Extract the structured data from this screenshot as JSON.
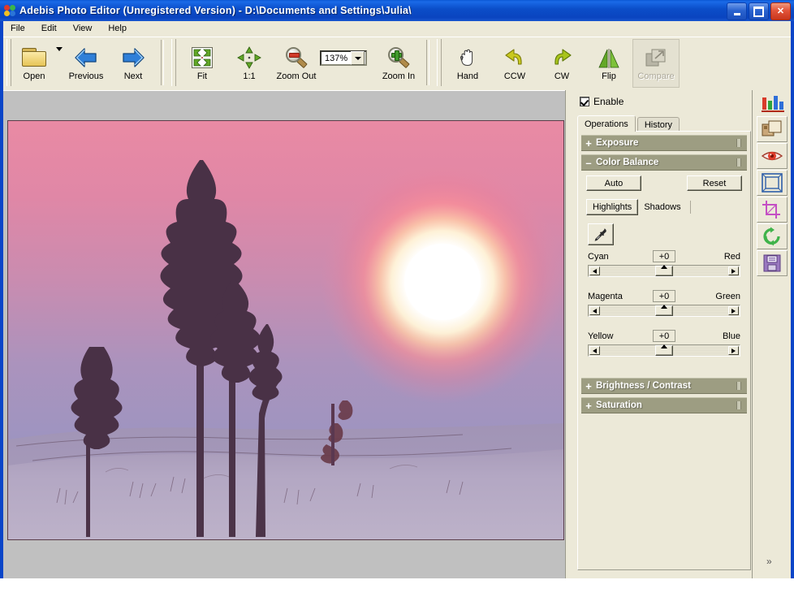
{
  "window": {
    "title": "Adebis Photo Editor (Unregistered Version) - D:\\Documents and Settings\\Julia\\",
    "app_icon": "photo-app-icon",
    "minimize_label": "_",
    "maximize_label": "□",
    "close_label": "✕"
  },
  "menu": {
    "items": [
      "File",
      "Edit",
      "View",
      "Help"
    ]
  },
  "toolbar": {
    "open": {
      "label": "Open",
      "icon": "folder-icon",
      "has_dropdown": true
    },
    "previous": {
      "label": "Previous",
      "icon": "arrow-left-icon"
    },
    "next": {
      "label": "Next",
      "icon": "arrow-right-icon"
    },
    "fit": {
      "label": "Fit",
      "icon": "fit-to-window-icon"
    },
    "actual": {
      "label": "1:1",
      "icon": "actual-size-icon"
    },
    "zoom_out": {
      "label": "Zoom Out",
      "icon": "magnifier-minus-icon"
    },
    "zoom_level": {
      "value": "137%",
      "icon": "chevron-down-icon"
    },
    "zoom_in": {
      "label": "Zoom In",
      "icon": "magnifier-plus-icon"
    },
    "hand": {
      "label": "Hand",
      "icon": "hand-icon"
    },
    "ccw": {
      "label": "CCW",
      "icon": "rotate-counterclockwise-icon"
    },
    "cw": {
      "label": "CW",
      "icon": "rotate-clockwise-icon"
    },
    "flip": {
      "label": "Flip",
      "icon": "flip-horizontal-icon"
    },
    "compare": {
      "label": "Compare",
      "icon": "compare-icon",
      "disabled": true
    }
  },
  "panel": {
    "enable": {
      "label": "Enable",
      "checked": true
    },
    "tabs": [
      {
        "label": "Operations",
        "active": true
      },
      {
        "label": "History",
        "active": false
      }
    ],
    "sections": [
      {
        "label": "Exposure",
        "state": "+",
        "expanded": false
      },
      {
        "label": "Color Balance",
        "state": "–",
        "expanded": true
      },
      {
        "label": "Brightness / Contrast",
        "state": "+",
        "expanded": false
      },
      {
        "label": "Saturation",
        "state": "+",
        "expanded": false
      }
    ],
    "color_balance": {
      "auto_label": "Auto",
      "reset_label": "Reset",
      "modes": [
        {
          "label": "Highlights",
          "selected": true
        },
        {
          "label": "Shadows",
          "selected": false
        }
      ],
      "picker_icon": "eyedropper-icon",
      "sliders": [
        {
          "left": "Cyan",
          "right": "Red",
          "value": "+0",
          "position": 50
        },
        {
          "left": "Magenta",
          "right": "Green",
          "value": "+0",
          "position": 50
        },
        {
          "left": "Yellow",
          "right": "Blue",
          "value": "+0",
          "position": 50
        }
      ],
      "arrow_left": "◄",
      "arrow_right": "►"
    }
  },
  "tool_strip": {
    "histogram_icon": "histogram-icon",
    "buttons": [
      {
        "icon": "color-correction-icon",
        "name": "color-correction"
      },
      {
        "icon": "red-eye-icon",
        "name": "red-eye-removal"
      },
      {
        "icon": "frame-icon",
        "name": "add-frame"
      },
      {
        "icon": "crop-icon",
        "name": "crop"
      },
      {
        "icon": "rotate-icon",
        "name": "rotate"
      },
      {
        "icon": "save-icon",
        "name": "save"
      }
    ],
    "expander_label": "»"
  },
  "canvas": {
    "background_color": "#c0c0c0",
    "photo": {
      "description": "Winter sunset: pink and lavender sky with a bright white sun, silhouetted pine trees on snowy field",
      "sky_top_color": "#e8849f",
      "sky_mid_color": "#d48fae",
      "sky_low_color": "#a495bd",
      "snow_color": "#b3a6c0",
      "sun_color": "#ffffff",
      "sun_glow_color": "#ff9a9a",
      "tree_color": "#463043",
      "border_color": "#5a3d49"
    }
  }
}
